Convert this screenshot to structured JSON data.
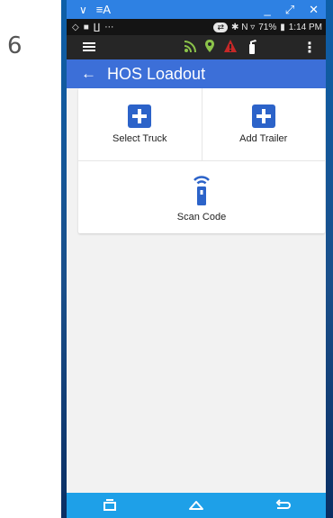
{
  "step": "6",
  "window": {
    "title": "≡A",
    "chevron": "∨",
    "minimize": "_",
    "restore": "⤢",
    "close": "✕"
  },
  "statusbar": {
    "left_icons": [
      "◇",
      "■",
      "∐",
      "⋯"
    ],
    "pill": "⇄",
    "right_icons": "✱ N ▿",
    "battery": "71%",
    "time": "1:14 PM"
  },
  "toolbar": {
    "icons": [
      "wifi-signal-icon",
      "location-pin-icon",
      "warning-icon",
      "fire-extinguisher-icon"
    ],
    "kebab": "⋮"
  },
  "appbar": {
    "back": "←",
    "title": "HOS Loadout"
  },
  "tiles": {
    "select_truck": "Select Truck",
    "add_trailer": "Add Trailer",
    "scan_code": "Scan Code"
  },
  "colors": {
    "accent": "#3c6fd8",
    "button": "#2c63c9",
    "navbar": "#1ea0e8",
    "wifi": "#8bc34a",
    "pin": "#8bc34a",
    "warning": "#c62828"
  }
}
